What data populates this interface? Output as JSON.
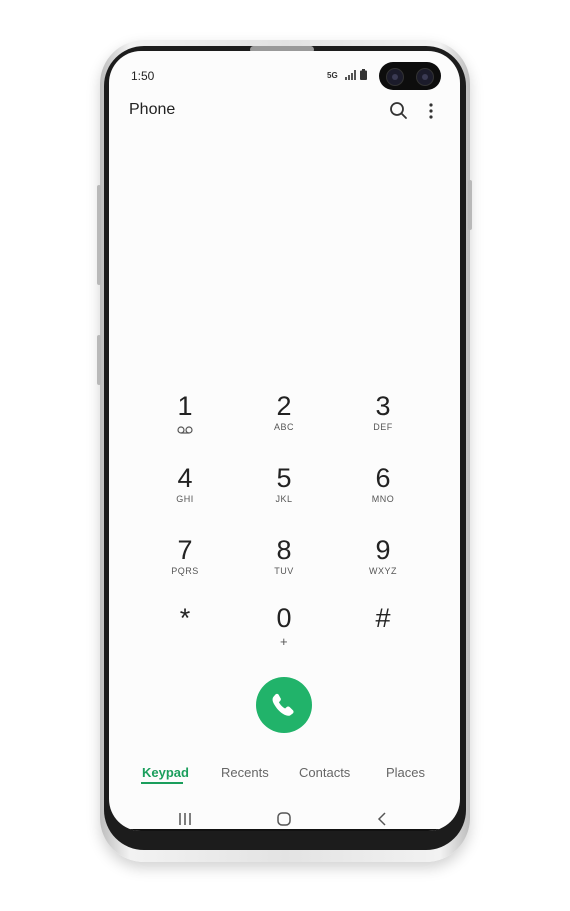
{
  "status_bar": {
    "time": "1:50",
    "network": "5G"
  },
  "app_bar": {
    "title": "Phone",
    "search_icon": "search-icon",
    "more_icon": "more-vertical-icon"
  },
  "keypad": {
    "keys": [
      {
        "digit": "1",
        "letters": "",
        "icon": "voicemail-icon"
      },
      {
        "digit": "2",
        "letters": "ABC"
      },
      {
        "digit": "3",
        "letters": "DEF"
      },
      {
        "digit": "4",
        "letters": "GHI"
      },
      {
        "digit": "5",
        "letters": "JKL"
      },
      {
        "digit": "6",
        "letters": "MNO"
      },
      {
        "digit": "7",
        "letters": "PQRS"
      },
      {
        "digit": "8",
        "letters": "TUV"
      },
      {
        "digit": "9",
        "letters": "WXYZ"
      },
      {
        "digit": "*",
        "letters": ""
      },
      {
        "digit": "0",
        "letters": "+"
      },
      {
        "digit": "#",
        "letters": ""
      }
    ]
  },
  "call_button": {
    "icon": "phone-icon",
    "color": "#21b36a"
  },
  "tabs": [
    {
      "label": "Keypad",
      "active": true
    },
    {
      "label": "Recents",
      "active": false
    },
    {
      "label": "Contacts",
      "active": false
    },
    {
      "label": "Places",
      "active": false
    }
  ],
  "accent_color": "#1a9e5c",
  "nav_bar": {
    "recents_icon": "recent-apps-icon",
    "home_icon": "home-icon",
    "back_icon": "back-icon"
  }
}
